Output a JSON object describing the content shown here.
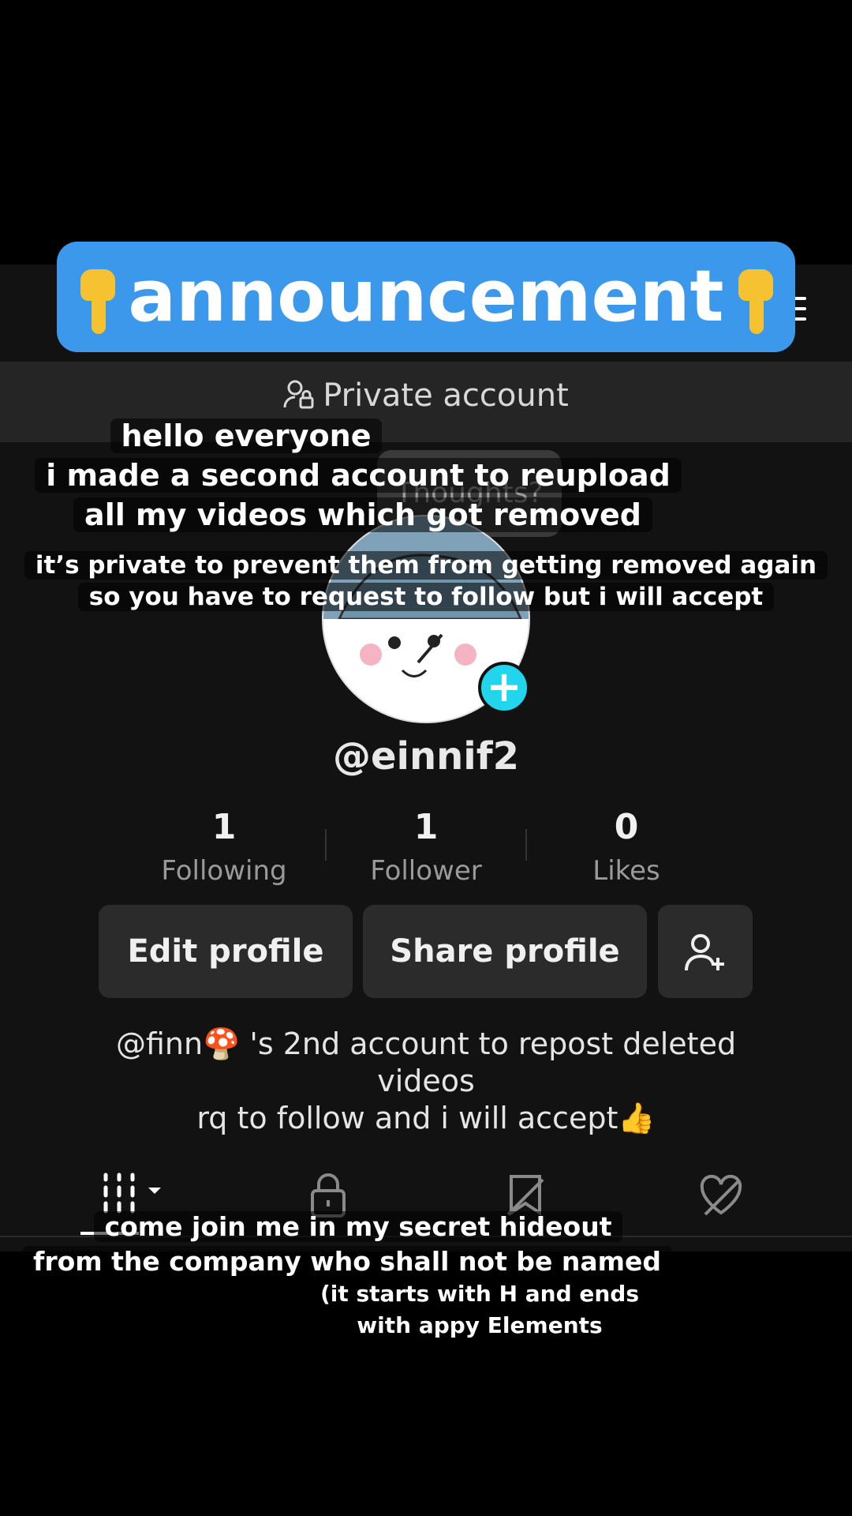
{
  "banner": {
    "text": "announcement",
    "emoji": "hand-pointing-down-icon"
  },
  "profile": {
    "private_label": "Private account",
    "thoughts_placeholder": "Thoughts?",
    "username": "@einnif2",
    "stats": [
      {
        "value": "1",
        "label": "Following"
      },
      {
        "value": "1",
        "label": "Follower"
      },
      {
        "value": "0",
        "label": "Likes"
      }
    ],
    "buttons": {
      "edit": "Edit profile",
      "share": "Share profile"
    },
    "bio": [
      "@finn🍄 's 2nd account to repost deleted",
      "videos",
      "rq to follow and i will accept👍"
    ]
  },
  "captions": {
    "line1": "hello everyone",
    "line2": "i made a second account to reupload",
    "line3": "all my videos which got removed",
    "line4": "it’s private to prevent them from getting removed again",
    "line5": "so you have to request to follow but i will accept",
    "line6": "come join me in my secret hideout",
    "line7": "from the company who shall not be named",
    "line8": "(it starts with H and ends",
    "line9": "with appy Elements"
  },
  "colors": {
    "accent_banner": "#3b98ea",
    "add_button": "#20d5ec",
    "background": "#121212"
  }
}
